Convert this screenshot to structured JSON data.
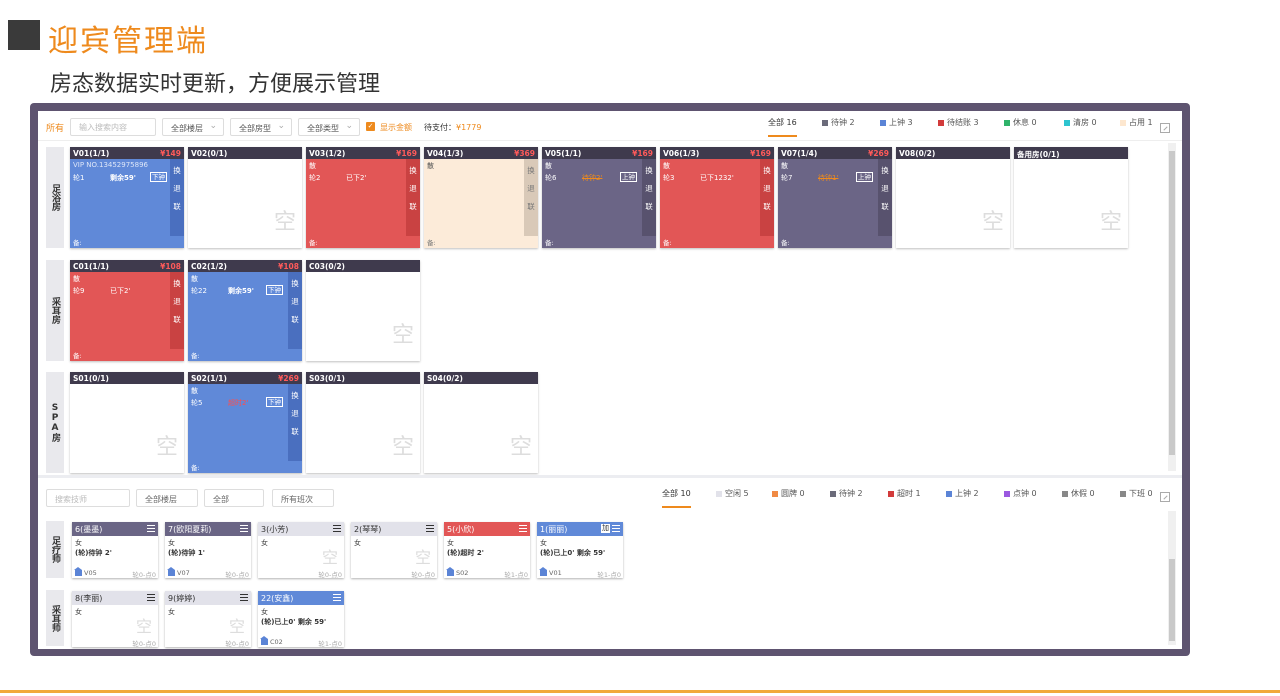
{
  "header": {
    "title": "迎宾管理端",
    "subtitle": "房态数据实时更新，方便展示管理"
  },
  "rooms_filter": {
    "all_label": "所有",
    "search_placeholder": "输入搜索内容",
    "floor_select": "全部楼层",
    "room_type_select": "全部房型",
    "type_select": "全部类型",
    "show_amount_label": "显示金额",
    "pending_pay_label": "待支付：",
    "pending_pay_value": "¥1779"
  },
  "room_tabs": [
    {
      "label": "全部 16",
      "color": ""
    },
    {
      "label": "待钟 2",
      "color": "#6b6b7a"
    },
    {
      "label": "上钟 3",
      "color": "#5b84d6"
    },
    {
      "label": "待结账 3",
      "color": "#d23b3b"
    },
    {
      "label": "休息 0",
      "color": "#2fb36a"
    },
    {
      "label": "清房 0",
      "color": "#2ec4cf"
    },
    {
      "label": "占用 1",
      "color": "#fde7cf"
    }
  ],
  "room_groups": [
    {
      "label": "足浴房"
    },
    {
      "label": "采耳房"
    },
    {
      "label": "SPA房"
    }
  ],
  "actions": {
    "swap": "换",
    "refund": "退",
    "link": "联"
  },
  "note_label": "备:",
  "empty_label": "空",
  "rooms": {
    "v01": {
      "name": "V01(1/1)",
      "price": "¥149",
      "vip": "VIP NO.13452975896",
      "round": "轮1",
      "remain": "剩余59'",
      "badge": "下钟"
    },
    "v02": {
      "name": "V02(0/1)"
    },
    "v03": {
      "name": "V03(1/2)",
      "price": "¥169",
      "tag": "散",
      "round": "轮2",
      "status": "已下2'"
    },
    "v04": {
      "name": "V04(1/3)",
      "price": "¥369",
      "tag": "散"
    },
    "v05": {
      "name": "V05(1/1)",
      "price": "¥169",
      "tag": "散",
      "round": "轮6",
      "status": "待钟2'",
      "badge": "上钟"
    },
    "v06": {
      "name": "V06(1/3)",
      "price": "¥169",
      "tag": "散",
      "round": "轮3",
      "status": "已下1232'"
    },
    "v07": {
      "name": "V07(1/4)",
      "price": "¥269",
      "tag": "散",
      "round": "轮7",
      "status": "待钟1'",
      "badge": "上钟"
    },
    "v08": {
      "name": "V08(0/2)"
    },
    "spare": {
      "name": "备用房(0/1)"
    },
    "c01": {
      "name": "C01(1/1)",
      "price": "¥108",
      "tag": "散",
      "round": "轮9",
      "status": "已下2'"
    },
    "c02": {
      "name": "C02(1/2)",
      "price": "¥108",
      "tag": "散",
      "round": "轮22",
      "remain": "剩余59'",
      "badge": "下钟"
    },
    "c03": {
      "name": "C03(0/2)"
    },
    "s01": {
      "name": "S01(0/1)"
    },
    "s02": {
      "name": "S02(1/1)",
      "price": "¥269",
      "tag": "散",
      "round": "轮5",
      "status": "超时2'",
      "badge": "下钟"
    },
    "s03": {
      "name": "S03(0/1)"
    },
    "s04": {
      "name": "S04(0/2)"
    }
  },
  "tech_filter": {
    "search_placeholder": "搜索技师",
    "floor_select": "全部楼层",
    "all_select": "全部",
    "shift_select": "所有班次"
  },
  "tech_tabs": [
    {
      "label": "全部 10",
      "color": ""
    },
    {
      "label": "空闲 5",
      "color": "#e2e2ea"
    },
    {
      "label": "圆牌 0",
      "color": "#f08a44"
    },
    {
      "label": "待钟 2",
      "color": "#6b6b7a"
    },
    {
      "label": "超时 1",
      "color": "#d23b3b"
    },
    {
      "label": "上钟 2",
      "color": "#5b84d6"
    },
    {
      "label": "点钟 0",
      "color": "#9b59e0"
    },
    {
      "label": "休假 0",
      "color": "#888888"
    },
    {
      "label": "下班 0",
      "color": "#888888"
    }
  ],
  "tech_groups": [
    {
      "label": "足疗师"
    },
    {
      "label": "采耳师"
    }
  ],
  "techs": {
    "t6": {
      "name": "6(墨墨)",
      "gender": "女",
      "status": "(轮)待钟 2'",
      "room": "V05",
      "count": "轮0-点0"
    },
    "t7": {
      "name": "7(欧阳夏莉)",
      "gender": "女",
      "status": "(轮)待钟 1'",
      "room": "V07",
      "count": "轮0-点0"
    },
    "t3": {
      "name": "3(小芳)",
      "gender": "女",
      "count": "轮0-点0"
    },
    "t2": {
      "name": "2(琴琴)",
      "gender": "女",
      "count": "轮0-点0"
    },
    "t5": {
      "name": "5(小欣)",
      "gender": "女",
      "status": "(轮)超时 2'",
      "room": "S02",
      "count": "轮1-点0"
    },
    "t1": {
      "name": "1(丽丽)",
      "gender": "女",
      "status": "(轮)已上0' 剩余 59'",
      "room": "V01",
      "count": "轮1-点0",
      "tag": "加"
    },
    "t8": {
      "name": "8(李丽)",
      "gender": "女",
      "count": "轮0-点0"
    },
    "t9": {
      "name": "9(婷婷)",
      "gender": "女",
      "count": "轮0-点0"
    },
    "t22": {
      "name": "22(安鑫)",
      "gender": "女",
      "status": "(轮)已上0' 剩余 59'",
      "room": "C02",
      "count": "轮1-点0"
    }
  }
}
